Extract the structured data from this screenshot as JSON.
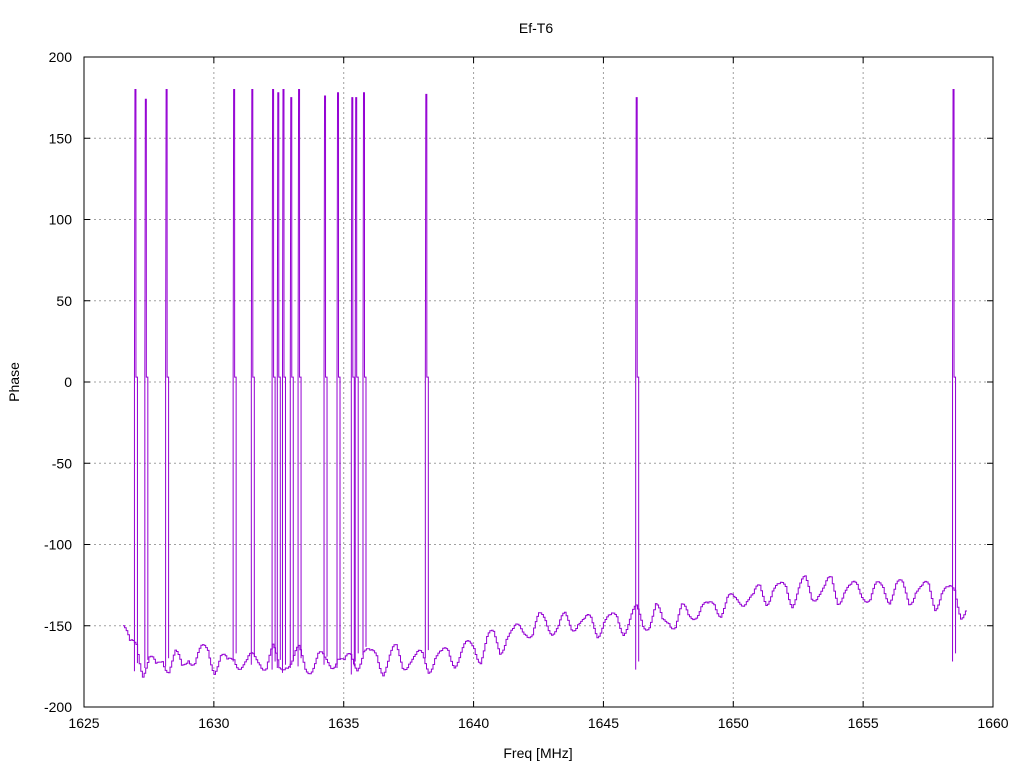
{
  "chart_data": {
    "type": "line",
    "title": "Ef-T6",
    "xlabel": "Freq [MHz]",
    "ylabel": "Phase",
    "xlim": [
      1625,
      1660
    ],
    "ylim": [
      -200,
      200
    ],
    "xticks": [
      "1625",
      "1630",
      "1635",
      "1640",
      "1645",
      "1650",
      "1655",
      "1660"
    ],
    "yticks": [
      "-200",
      "-150",
      "-100",
      "-50",
      "0",
      "50",
      "100",
      "150",
      "200"
    ],
    "grid": true,
    "series_color": "#9400d3",
    "baseline": {
      "x_start": 1626.5,
      "x_step": 0.25,
      "y": [
        -150,
        -165,
        -160,
        -176,
        -172,
        -178,
        -168,
        -175,
        -170,
        -177,
        -166,
        -172,
        -168,
        -165,
        -174,
        -170,
        -176,
        -168,
        -172,
        -175,
        -171,
        -169,
        -174,
        -167,
        -177,
        -170,
        -172,
        -168,
        -175,
        -173,
        -170,
        -174,
        -172,
        -167,
        -176,
        -170,
        -172,
        -165,
        -171,
        -168,
        -175,
        -170,
        -167,
        -173,
        -169,
        -172,
        -170,
        -174,
        -168,
        -171,
        -166,
        -170,
        -167,
        -165,
        -162,
        -168,
        -160,
        -158,
        -163,
        -155,
        -157,
        -152,
        -150,
        -155,
        -148,
        -146,
        -150,
        -152,
        -147,
        -149,
        -145,
        -150,
        -148,
        -152,
        -146,
        -149,
        -145,
        -150,
        -147,
        -143,
        -148,
        -146,
        -140,
        -150,
        -144,
        -148,
        -142,
        -145,
        -140,
        -138,
        -142,
        -136,
        -139,
        -135,
        -137,
        -133,
        -131,
        -135,
        -128,
        -132,
        -127,
        -130,
        -126,
        -133,
        -128,
        -125,
        -131,
        -127,
        -129,
        -124,
        -132,
        -127,
        -130,
        -126,
        -128,
        -134,
        -129,
        -125,
        -131,
        -127,
        -128,
        -133,
        -126,
        -130,
        -127,
        -135,
        -129,
        -132,
        -128,
        -140
      ]
    },
    "spikes": [
      {
        "x": 1627.0,
        "peak": 180,
        "low": -178
      },
      {
        "x": 1627.4,
        "peak": 174,
        "low": -176
      },
      {
        "x": 1628.2,
        "peak": 180,
        "low": -175
      },
      {
        "x": 1630.8,
        "peak": 180,
        "low": -172
      },
      {
        "x": 1631.5,
        "peak": 180,
        "low": -174
      },
      {
        "x": 1632.3,
        "peak": 180,
        "low": -177
      },
      {
        "x": 1632.5,
        "peak": 178,
        "low": -176
      },
      {
        "x": 1632.7,
        "peak": 180,
        "low": -179
      },
      {
        "x": 1633.0,
        "peak": 175,
        "low": -176
      },
      {
        "x": 1633.3,
        "peak": 180,
        "low": -175
      },
      {
        "x": 1634.3,
        "peak": 176,
        "low": -174
      },
      {
        "x": 1634.8,
        "peak": 178,
        "low": -176
      },
      {
        "x": 1635.35,
        "peak": 175,
        "low": -180
      },
      {
        "x": 1635.5,
        "peak": 175,
        "low": -172
      },
      {
        "x": 1635.8,
        "peak": 178,
        "low": -168
      },
      {
        "x": 1638.2,
        "peak": 177,
        "low": -170
      },
      {
        "x": 1646.3,
        "peak": 175,
        "low": -177
      },
      {
        "x": 1658.5,
        "peak": 180,
        "low": -172
      }
    ]
  }
}
